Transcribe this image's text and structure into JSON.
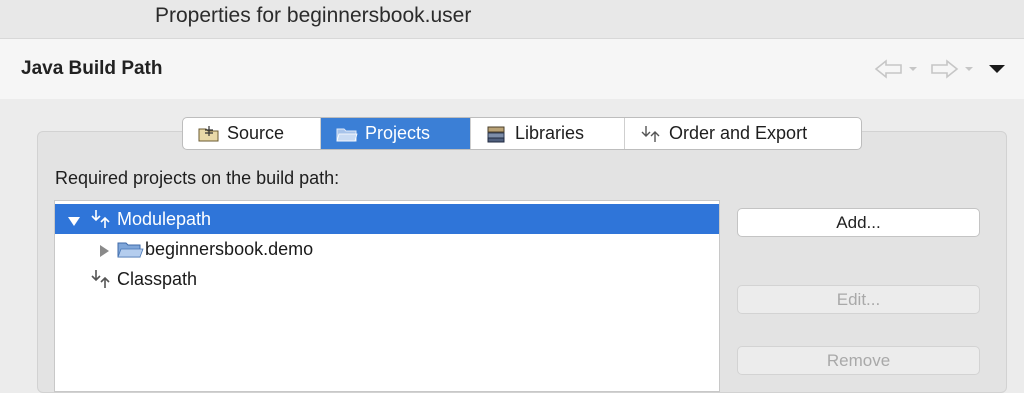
{
  "window": {
    "title": "Properties for beginnersbook.user"
  },
  "header": {
    "title": "Java Build Path",
    "nav_back_icon": "back-arrow-icon",
    "nav_forward_icon": "forward-arrow-icon",
    "view_menu_icon": "chevron-down-icon"
  },
  "tabs": [
    {
      "label": "Source",
      "icon": "source-folder-icon",
      "active": false
    },
    {
      "label": "Projects",
      "icon": "project-folder-icon",
      "active": true
    },
    {
      "label": "Libraries",
      "icon": "library-icon",
      "active": false
    },
    {
      "label": "Order and Export",
      "icon": "order-arrows-icon",
      "active": false
    }
  ],
  "list": {
    "label": "Required projects on the build path:",
    "items": [
      {
        "label": "Modulepath",
        "expanded": true,
        "selected": true,
        "icon": "modulepath-icon"
      },
      {
        "label": "beginnersbook.demo",
        "expanded": false,
        "selected": false,
        "icon": "project-folder-icon"
      },
      {
        "label": "Classpath",
        "expanded": false,
        "selected": false,
        "icon": "classpath-icon"
      }
    ]
  },
  "buttons": {
    "add": "Add...",
    "edit": "Edit...",
    "remove": "Remove"
  },
  "colors": {
    "accent": "#3b7fd6",
    "selection": "#2f75d9",
    "background": "#ececec"
  }
}
